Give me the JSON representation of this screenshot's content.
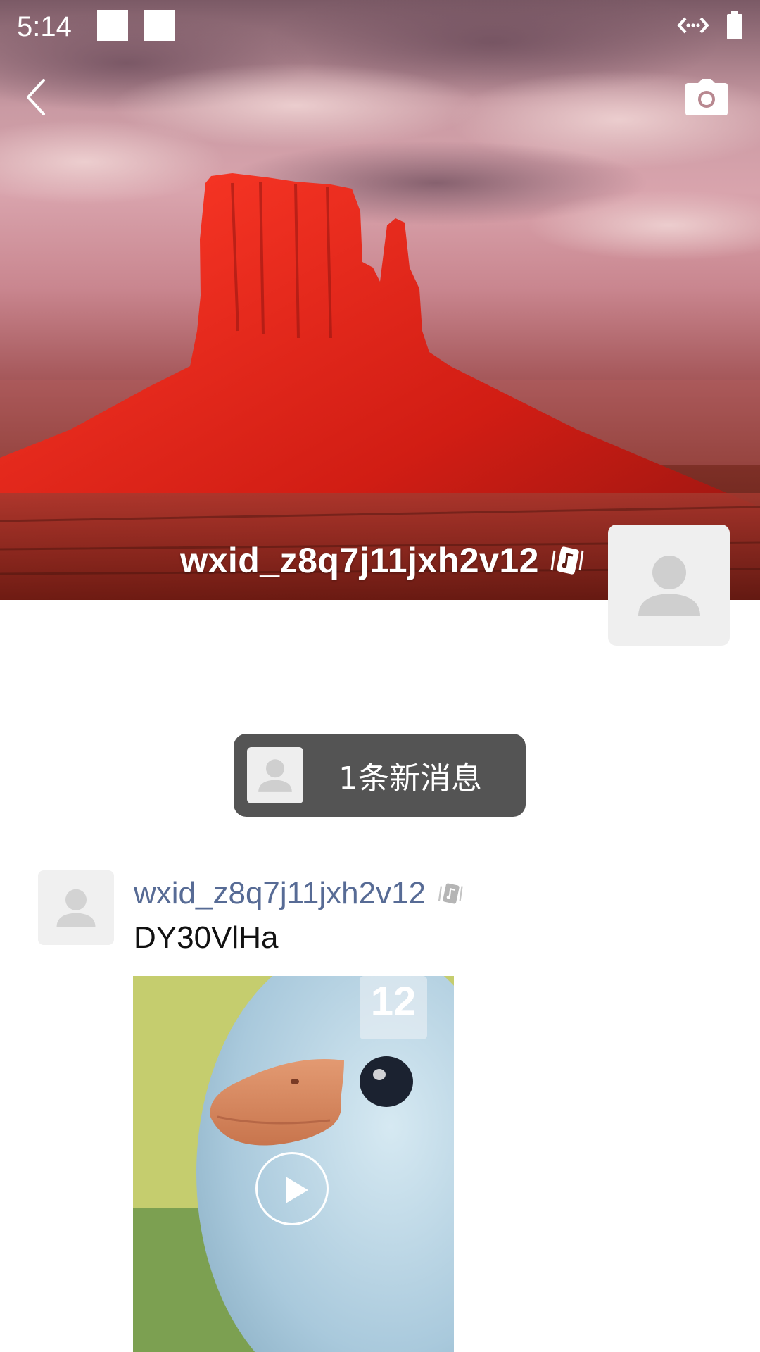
{
  "status_bar": {
    "time": "5:14",
    "icons": [
      "notification-square",
      "notification-square",
      "vpn-icon",
      "battery-icon"
    ]
  },
  "top_bar": {
    "back_icon": "chevron-left-icon",
    "camera_icon": "camera-icon"
  },
  "profile": {
    "username": "wxid_z8q7j11jxh2v12",
    "tag_icon": "music-card-icon",
    "avatar_icon": "person-placeholder-icon"
  },
  "new_messages": {
    "label": "1条新消息"
  },
  "post": {
    "author": "wxid_z8q7j11jxh2v12",
    "text": "DY30VlHa",
    "media_type": "video",
    "video_overlay": {
      "number": "12"
    }
  },
  "colors": {
    "link_blue": "#576b95",
    "pill_bg": "#545454",
    "avatar_bg": "#efefef"
  }
}
